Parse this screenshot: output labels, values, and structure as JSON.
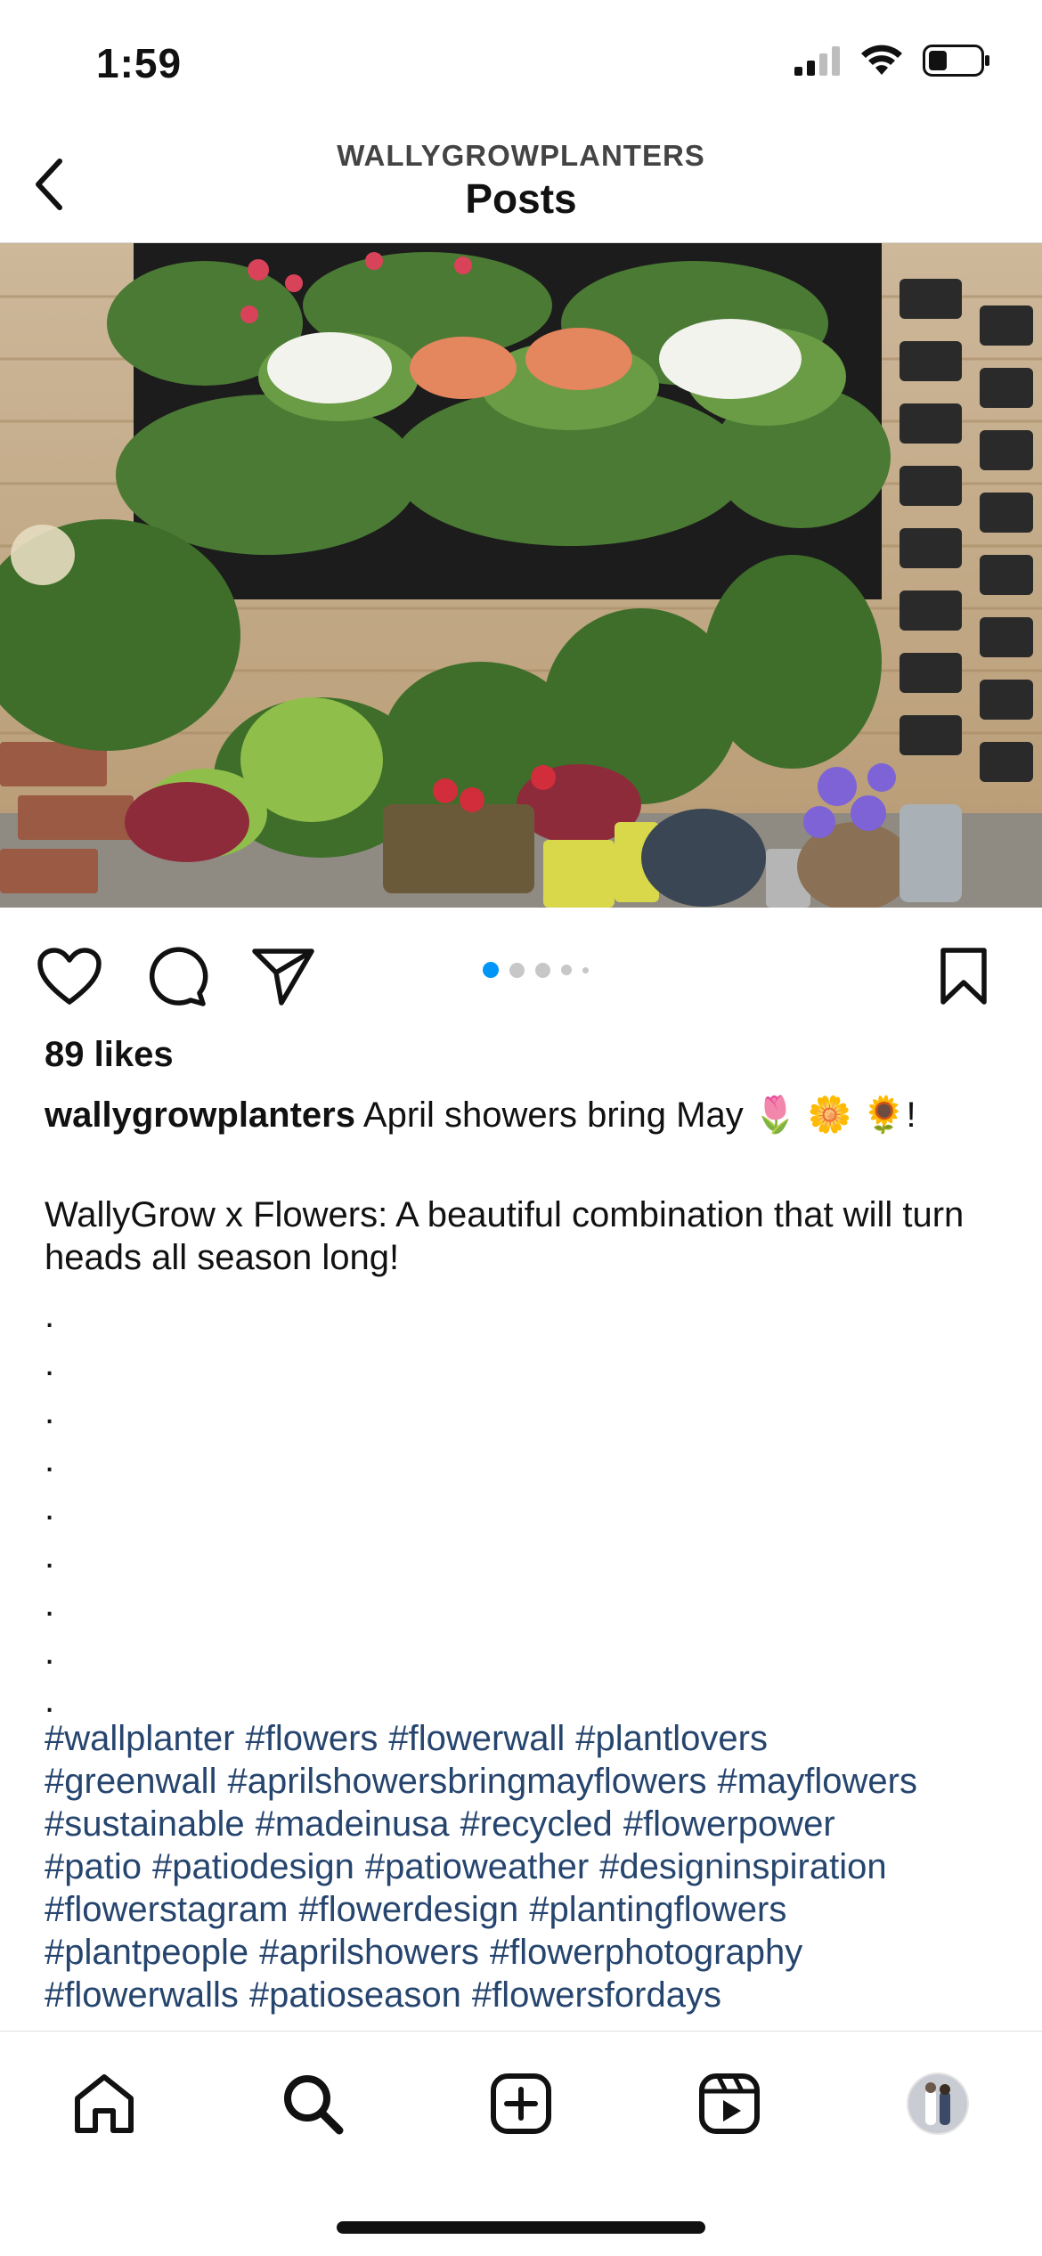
{
  "status": {
    "time": "1:59"
  },
  "header": {
    "account": "WALLYGROWPLANTERS",
    "title": "Posts"
  },
  "post": {
    "likes": "89 likes",
    "username": "wallygrowplanters",
    "caption_line1": "April showers bring May 🌷 🌼 🌻!",
    "caption_para2": "WallyGrow x Flowers: A beautiful combination that will turn heads all season long!",
    "separator_dots": [
      ".",
      ".",
      ".",
      ".",
      ".",
      ".",
      ".",
      ".",
      "."
    ],
    "hashtags": [
      "#wallplanter",
      "#flowers",
      "#flowerwall",
      "#plantlovers",
      "#greenwall",
      "#aprilshowersbringmayflowers",
      "#mayflowers",
      "#sustainable",
      "#madeinusa",
      "#recycled",
      "#flowerpower",
      "#patio",
      "#patiodesign",
      "#patioweather",
      "#designinspiration",
      "#flowerstagram",
      "#flowerdesign",
      "#plantingflowers",
      "#plantpeople",
      "#aprilshowers",
      "#flowerphotography",
      "#flowerwalls",
      "#patioseason",
      "#flowersfordays"
    ],
    "carousel": {
      "count": 5,
      "active_index": 0
    }
  },
  "colors": {
    "hashtag": "#26456e",
    "carousel_active": "#0095f6",
    "carousel_inactive": "#c7c7c7"
  },
  "icons": {
    "back": "chevron-left-icon",
    "like": "heart-icon",
    "comment": "comment-bubble-icon",
    "share": "paper-plane-icon",
    "save": "bookmark-icon",
    "tabs": [
      "home-icon",
      "search-icon",
      "plus-square-icon",
      "reels-icon",
      "profile-avatar"
    ]
  }
}
